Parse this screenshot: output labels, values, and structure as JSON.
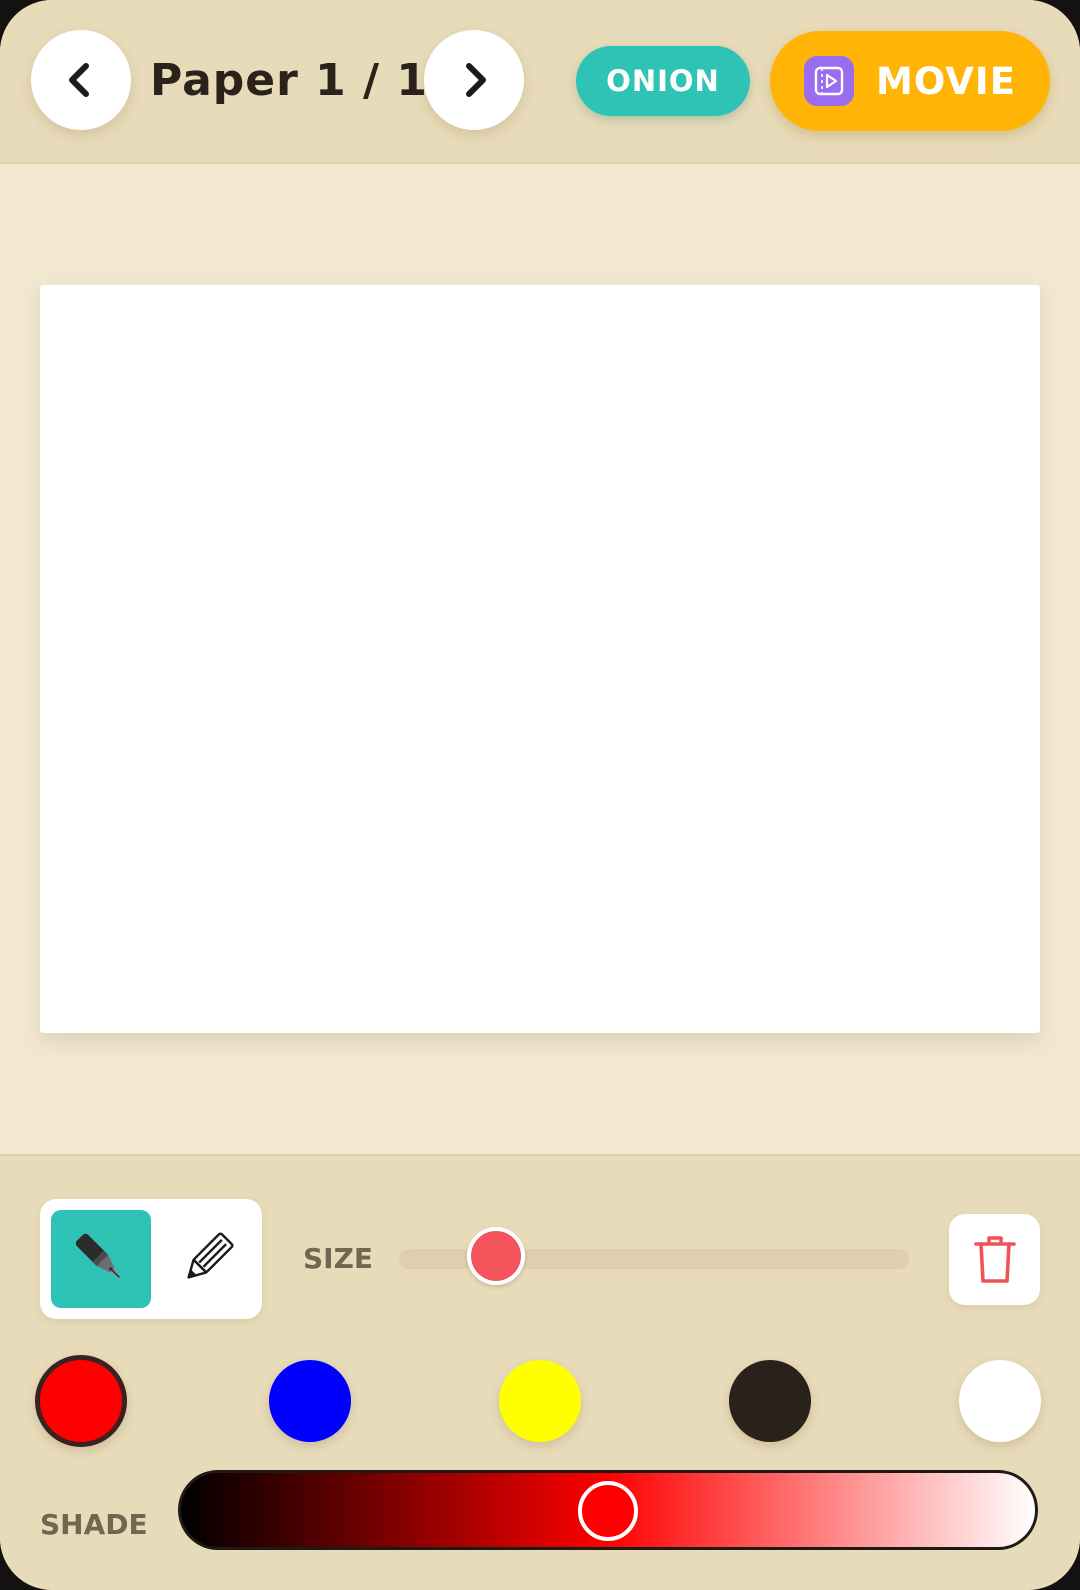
{
  "header": {
    "prev_icon": "chevron-left-icon",
    "next_icon": "chevron-right-icon",
    "page_title": "Paper 1 / 1",
    "onion_label": "ONION",
    "movie_label": "MOVIE",
    "movie_icon": "movie-icon"
  },
  "toolbar": {
    "tools": [
      {
        "name": "pen",
        "icon": "pen-icon",
        "selected": true
      },
      {
        "name": "pencil",
        "icon": "pencil-icon",
        "selected": false
      }
    ],
    "size_label": "SIZE",
    "size_value": 0.19,
    "trash_icon": "trash-icon",
    "colors": [
      "#ff0000",
      "#0000ff",
      "#ffff00",
      "#2b211b",
      "#ffffff"
    ],
    "selected_color_index": 0,
    "shade_label": "SHADE",
    "shade_gradient": [
      "#000000",
      "#ff0000",
      "#ffffff"
    ],
    "shade_value": 0.5,
    "shade_thumb_color": "#ff0000"
  },
  "colors": {
    "accent_teal": "#2fc3b5",
    "accent_orange": "#ffb406",
    "size_thumb": "#f6545c",
    "trash": "#ee5357"
  }
}
